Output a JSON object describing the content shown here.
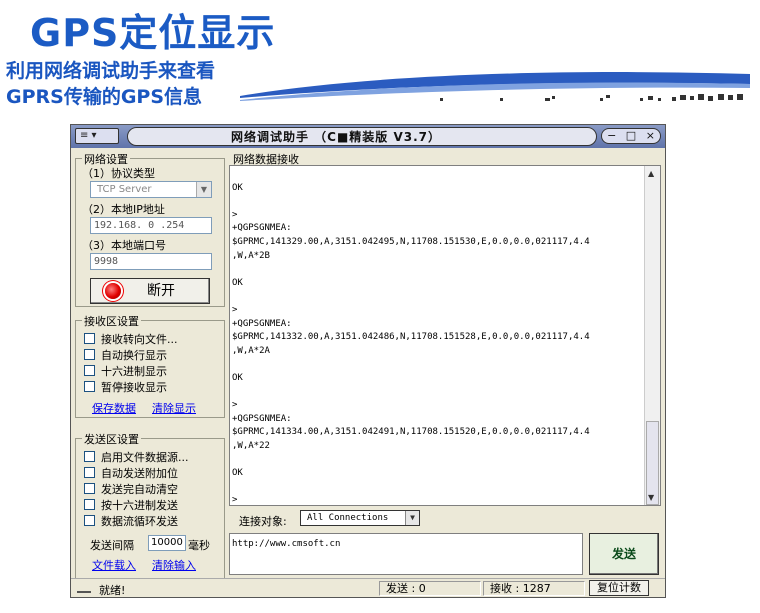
{
  "slide": {
    "title": "GPS定位显示",
    "subtitle_line1": "利用网络调试助手来查看",
    "subtitle_line2": "GPRS传输的GPS信息"
  },
  "window": {
    "menu_label": "≡ ▾",
    "title": "网络调试助手 （C■精装版 V3.7）",
    "controls": [
      "−",
      "□",
      "×"
    ]
  },
  "network_settings": {
    "legend": "网络设置",
    "protocol_label": "（1）协议类型",
    "protocol_value": "TCP Server",
    "local_ip_label": "（2）本地IP地址",
    "local_ip_value": "192.168. 0 .254",
    "local_port_label": "（3）本地端口号",
    "local_port_value": "9998",
    "open_button": "断开"
  },
  "receive_settings": {
    "legend": "接收区设置",
    "options": [
      "接收转向文件...",
      "自动换行显示",
      "十六进制显示",
      "暂停接收显示"
    ],
    "save_link": "保存数据",
    "clear_link": "清除显示"
  },
  "send_settings": {
    "legend": "发送区设置",
    "options": [
      "启用文件数据源...",
      "自动发送附加位",
      "发送完自动清空",
      "按十六进制发送",
      "数据流循环发送"
    ],
    "interval_label": "发送间隔",
    "interval_value": "10000",
    "interval_unit": "毫秒",
    "file_link": "文件载入",
    "clear_link": "清除输入"
  },
  "receive_area": {
    "legend": "网络数据接收",
    "lines": [
      "",
      "OK",
      "",
      ">",
      "+QGPSGNMEA:",
      "$GPRMC,141329.00,A,3151.042495,N,11708.151530,E,0.0,0.0,021117,4.4",
      ",W,A*2B",
      "",
      "OK",
      "",
      ">",
      "+QGPSGNMEA:",
      "$GPRMC,141332.00,A,3151.042486,N,11708.151528,E,0.0,0.0,021117,4.4",
      ",W,A*2A",
      "",
      "OK",
      "",
      ">",
      "+QGPSGNMEA:",
      "$GPRMC,141334.00,A,3151.042491,N,11708.151520,E,0.0,0.0,021117,4.4",
      ",W,A*22",
      "",
      "OK",
      "",
      ">"
    ]
  },
  "connection": {
    "label": "连接对象:",
    "value": "All Connections"
  },
  "send_area": {
    "text": "http://www.cmsoft.cn",
    "send_button": "发送"
  },
  "status": {
    "ready": "就绪!",
    "sent_label": "发送 : 0",
    "recv_label": "接收 : 1287",
    "reset_button": "复位计数"
  }
}
